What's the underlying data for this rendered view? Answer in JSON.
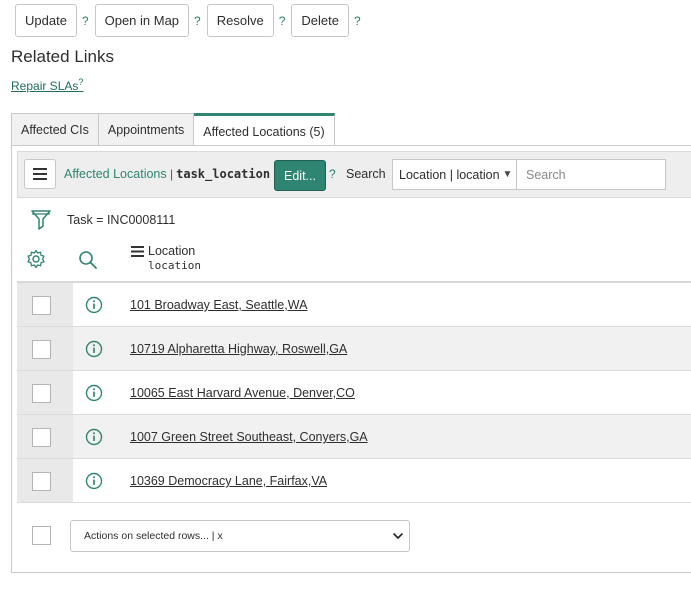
{
  "toolbar": {
    "buttons": [
      {
        "label": "Update",
        "help": "?"
      },
      {
        "label": "Open in Map",
        "help": "?"
      },
      {
        "label": "Resolve",
        "help": "?"
      },
      {
        "label": "Delete",
        "help": "?"
      }
    ]
  },
  "related": {
    "title": "Related Links",
    "link_label": "Repair SLAs",
    "link_help": "?"
  },
  "tabs": [
    {
      "label": "Affected CIs",
      "active": false
    },
    {
      "label": "Appointments",
      "active": false
    },
    {
      "label": "Affected Locations (5)",
      "active": true
    }
  ],
  "list": {
    "title": "Affected Locations",
    "separator": "|",
    "table_name": "task_location",
    "edit_label": "Edit...",
    "help": "?",
    "search_label": "Search",
    "search_field": "Location | location",
    "search_placeholder": "Search",
    "filter": "Task = INC0008111",
    "column_label": "Location",
    "column_field": "location",
    "rows": [
      "101 Broadway East, Seattle,WA",
      "10719 Alpharetta Highway, Roswell,GA",
      "10065 East Harvard Avenue, Denver,CO",
      "1007 Green Street Southeast, Conyers,GA",
      "10369 Democracy Lane, Fairfax,VA"
    ],
    "actions_label": "Actions on selected rows... | x"
  },
  "icons": {
    "menu": "hamburger-icon",
    "filter": "funnel-icon",
    "settings": "gear-icon",
    "search": "search-icon",
    "info": "info-icon",
    "dropdown": "chevron-down-icon"
  },
  "colors": {
    "accent": "#2e8571",
    "row_alt": "#f1f1f1"
  }
}
